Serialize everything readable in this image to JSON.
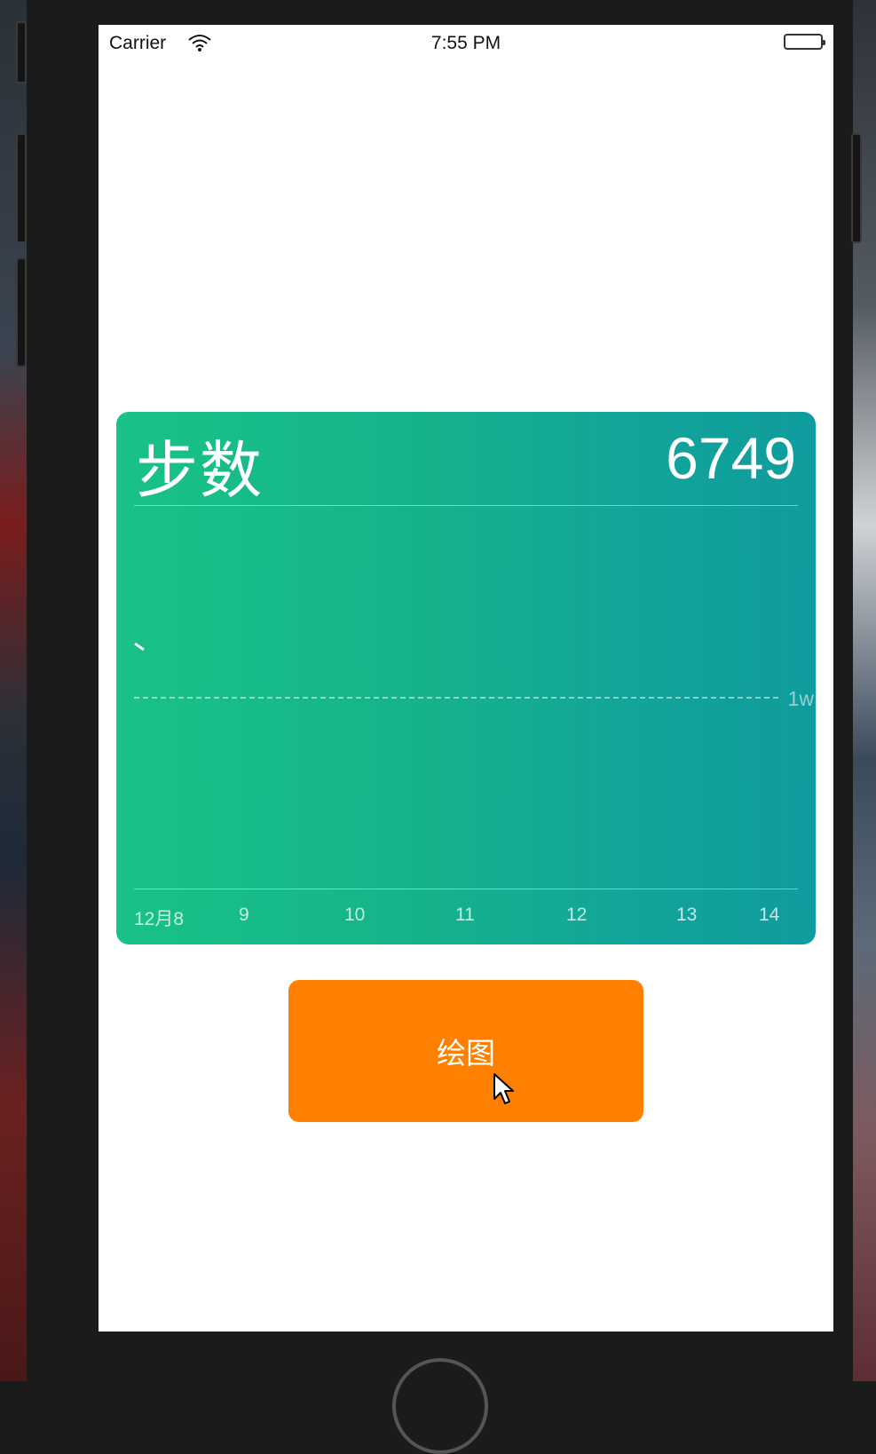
{
  "status_bar": {
    "carrier": "Carrier",
    "time": "7:55 PM"
  },
  "card": {
    "title": "步数",
    "value": "6749",
    "reference_label": "1w",
    "gradient_start": "#19c287",
    "gradient_end": "#0f9c9e"
  },
  "chart_data": {
    "type": "line",
    "categories": [
      "12月8",
      "9",
      "10",
      "11",
      "12",
      "13",
      "14"
    ],
    "reference_line": {
      "label": "1w",
      "value": 10000
    }
  },
  "button": {
    "label": "绘图",
    "color": "#ff8000"
  }
}
